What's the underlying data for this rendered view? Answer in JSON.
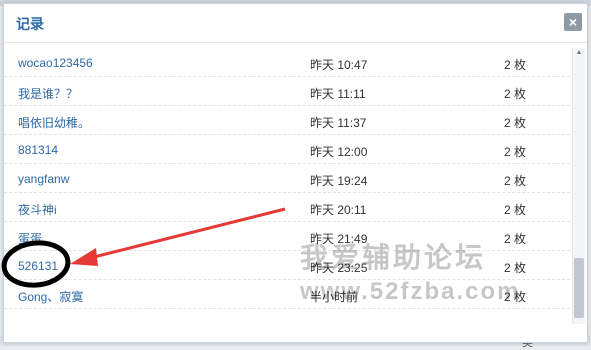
{
  "dialog": {
    "title": "记录",
    "close_label": "×"
  },
  "records": [
    {
      "user": "wocao123456",
      "time": "昨天 10:47",
      "count": "2 枚"
    },
    {
      "user": "我是谁？？",
      "time": "昨天 11:11",
      "count": "2 枚"
    },
    {
      "user": "唱依旧幼稚。",
      "time": "昨天 11:37",
      "count": "2 枚"
    },
    {
      "user": "881314",
      "time": "昨天 12:00",
      "count": "2 枚"
    },
    {
      "user": "yangfanw",
      "time": "昨天 19:24",
      "count": "2 枚"
    },
    {
      "user": "夜斗神i",
      "time": "昨天 20:11",
      "count": "2 枚"
    },
    {
      "user": "蛋蛋...",
      "time": "昨天 21:49",
      "count": "2 枚"
    },
    {
      "user": "526131",
      "time": "昨天 23:25",
      "count": "2 枚"
    },
    {
      "user": "Gong、寂寞",
      "time": "半小时前",
      "count": "2 枚"
    }
  ],
  "watermark": {
    "line1": "我爱辅助论坛",
    "line2": "www.52fzba.com"
  },
  "annotation_colors": {
    "arrow": "#e53935",
    "circle": "#000000"
  },
  "background_fragment": "奖"
}
